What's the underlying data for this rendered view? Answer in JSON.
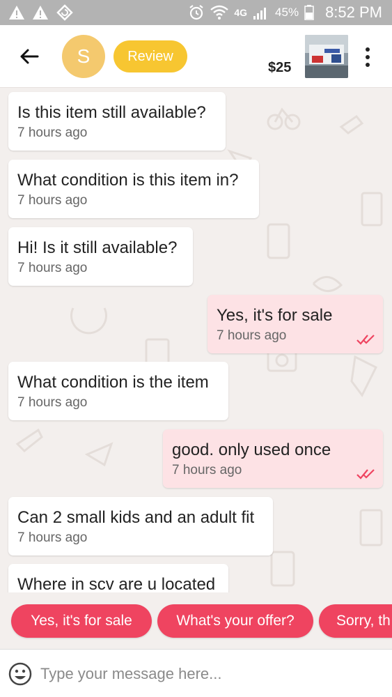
{
  "status_bar": {
    "network": "4G",
    "battery": "45%",
    "time": "8:52 PM"
  },
  "header": {
    "avatar_letter": "S",
    "review_label": "Review",
    "price": "$25"
  },
  "messages": [
    {
      "text": "Is this item still available?",
      "time": "7 hours ago",
      "direction": "in"
    },
    {
      "text": "What condition is this item in?",
      "time": "7 hours ago",
      "direction": "in"
    },
    {
      "text": "Hi! Is it still available?",
      "time": "7 hours ago",
      "direction": "in"
    },
    {
      "text": "Yes, it's for sale",
      "time": "7 hours ago",
      "direction": "out"
    },
    {
      "text": "What condition is the item",
      "time": "7 hours ago",
      "direction": "in"
    },
    {
      "text": "good. only used once",
      "time": "7 hours ago",
      "direction": "out"
    },
    {
      "text": "Can 2 small kids and an adult fit",
      "time": "7 hours ago",
      "direction": "in"
    },
    {
      "text": "Where in scv are u located",
      "time": "",
      "direction": "in"
    }
  ],
  "quick_replies": [
    "Yes, it's for sale",
    "What's your offer?",
    "Sorry, th"
  ],
  "input": {
    "placeholder": "Type your message here..."
  },
  "colors": {
    "accent": "#ef4460",
    "review": "#f7c631",
    "avatar": "#f4c96e",
    "outgoing_bubble": "#fde2e5",
    "status_bar": "#b3b3b3",
    "read_check": "#ef4460"
  },
  "icons": {
    "back": "arrow-left-icon",
    "more": "more-vertical-icon",
    "read": "double-check-icon",
    "emoji": "smiley-icon"
  }
}
